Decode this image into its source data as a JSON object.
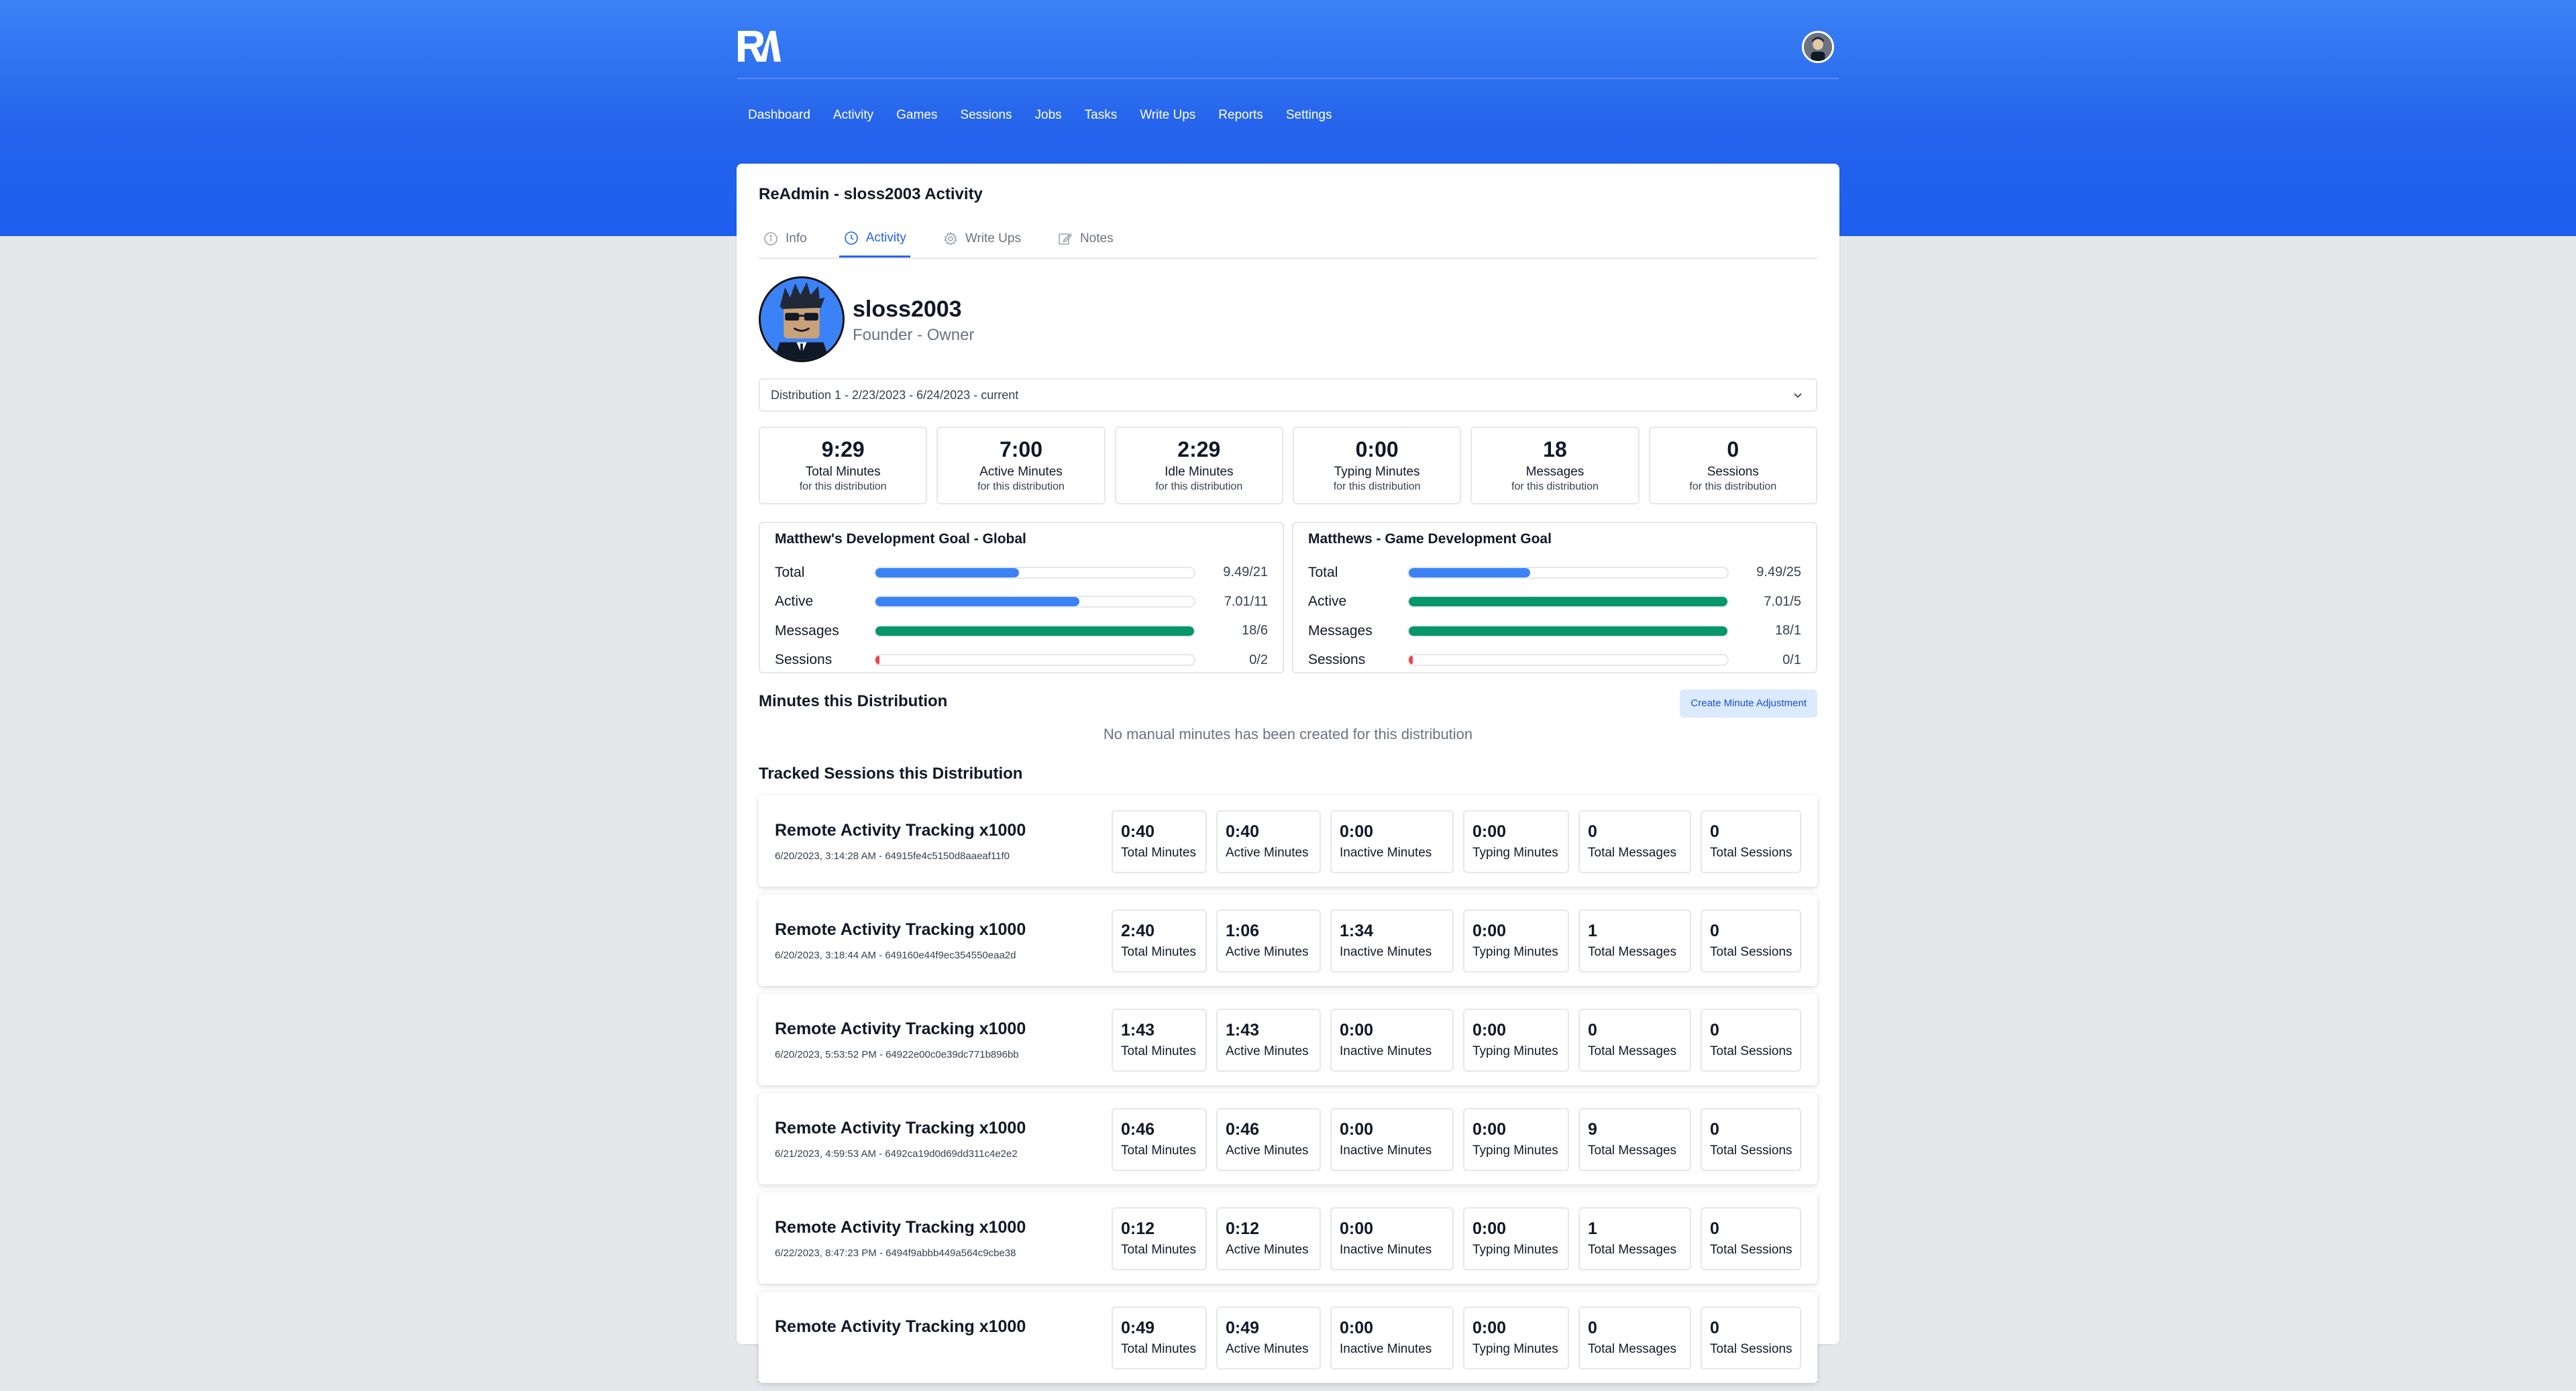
{
  "header": {
    "logo_text": "RA",
    "nav": [
      "Dashboard",
      "Activity",
      "Games",
      "Sessions",
      "Jobs",
      "Tasks",
      "Write Ups",
      "Reports",
      "Settings"
    ]
  },
  "page": {
    "title": "ReAdmin - sloss2003 Activity",
    "tabs": [
      {
        "label": "Info",
        "icon": "info-icon",
        "active": false
      },
      {
        "label": "Activity",
        "icon": "clock-icon",
        "active": true
      },
      {
        "label": "Write Ups",
        "icon": "gear-icon",
        "active": false
      },
      {
        "label": "Notes",
        "icon": "edit-icon",
        "active": false
      }
    ]
  },
  "profile": {
    "name": "sloss2003",
    "role": "Founder - Owner"
  },
  "distribution": {
    "selected": "Distribution 1 - 2/23/2023 - 6/24/2023 - current"
  },
  "stats": [
    {
      "value": "9:29",
      "label": "Total Minutes",
      "sub": "for this distribution"
    },
    {
      "value": "7:00",
      "label": "Active Minutes",
      "sub": "for this distribution"
    },
    {
      "value": "2:29",
      "label": "Idle Minutes",
      "sub": "for this distribution"
    },
    {
      "value": "0:00",
      "label": "Typing Minutes",
      "sub": "for this distribution"
    },
    {
      "value": "18",
      "label": "Messages",
      "sub": "for this distribution"
    },
    {
      "value": "0",
      "label": "Sessions",
      "sub": "for this distribution"
    }
  ],
  "goals": [
    {
      "title": "Matthew's Development Goal - Global",
      "rows": [
        {
          "label": "Total",
          "value": "9.49/21",
          "progress": 0.45,
          "color": "#3b82f6"
        },
        {
          "label": "Active",
          "value": "7.01/11",
          "progress": 0.64,
          "color": "#3b82f6"
        },
        {
          "label": "Messages",
          "value": "18/6",
          "progress": 1.0,
          "color": "#059669"
        },
        {
          "label": "Sessions",
          "value": "0/2",
          "progress": 0.0,
          "color": "#ef4444"
        }
      ]
    },
    {
      "title": "Matthews - Game Development Goal",
      "rows": [
        {
          "label": "Total",
          "value": "9.49/25",
          "progress": 0.38,
          "color": "#3b82f6"
        },
        {
          "label": "Active",
          "value": "7.01/5",
          "progress": 1.0,
          "color": "#059669"
        },
        {
          "label": "Messages",
          "value": "18/1",
          "progress": 1.0,
          "color": "#059669"
        },
        {
          "label": "Sessions",
          "value": "0/1",
          "progress": 0.0,
          "color": "#ef4444"
        }
      ]
    }
  ],
  "minutes_section": {
    "title": "Minutes this Distribution",
    "button": "Create Minute Adjustment",
    "empty": "No manual minutes has been created for this distribution"
  },
  "sessions_section": {
    "title": "Tracked Sessions this Distribution",
    "metric_labels": [
      "Total Minutes",
      "Active Minutes",
      "Inactive Minutes",
      "Typing Minutes",
      "Total Messages",
      "Total Sessions"
    ],
    "items": [
      {
        "name": "Remote Activity Tracking x1000",
        "meta": "6/20/2023, 3:14:28 AM - 64915fe4c5150d8aaeaf11f0",
        "values": [
          "0:40",
          "0:40",
          "0:00",
          "0:00",
          "0",
          "0"
        ]
      },
      {
        "name": "Remote Activity Tracking x1000",
        "meta": "6/20/2023, 3:18:44 AM - 649160e44f9ec354550eaa2d",
        "values": [
          "2:40",
          "1:06",
          "1:34",
          "0:00",
          "1",
          "0"
        ]
      },
      {
        "name": "Remote Activity Tracking x1000",
        "meta": "6/20/2023, 5:53:52 PM - 64922e00c0e39dc771b896bb",
        "values": [
          "1:43",
          "1:43",
          "0:00",
          "0:00",
          "0",
          "0"
        ]
      },
      {
        "name": "Remote Activity Tracking x1000",
        "meta": "6/21/2023, 4:59:53 AM - 6492ca19d0d69dd311c4e2e2",
        "values": [
          "0:46",
          "0:46",
          "0:00",
          "0:00",
          "9",
          "0"
        ]
      },
      {
        "name": "Remote Activity Tracking x1000",
        "meta": "6/22/2023, 8:47:23 PM - 6494f9abbb449a564c9cbe38",
        "values": [
          "0:12",
          "0:12",
          "0:00",
          "0:00",
          "1",
          "0"
        ]
      },
      {
        "name": "Remote Activity Tracking x1000",
        "meta": "",
        "values": [
          "0:49",
          "0:49",
          "0:00",
          "0:00",
          "0",
          "0"
        ]
      }
    ]
  }
}
